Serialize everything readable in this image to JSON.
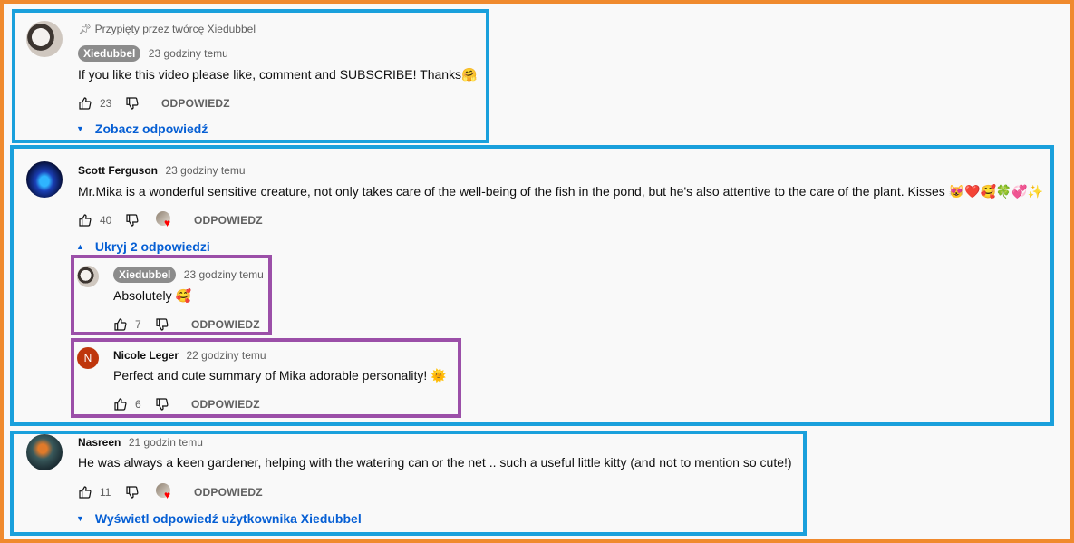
{
  "comments": [
    {
      "pinned_label": "Przypięty przez twórcę Xiedubbel",
      "author": "Xiedubbel",
      "time": "23 godziny temu",
      "text": "If you like this video please like, comment and SUBSCRIBE! Thanks🤗",
      "likes": "23",
      "reply_label": "ODPOWIEDZ",
      "toggle_label": "Zobacz odpowiedź"
    },
    {
      "author": "Scott Ferguson",
      "time": "23 godziny temu",
      "text": "Mr.Mika is a wonderful sensitive creature, not only takes care of the well-being of the fish in the pond, but he's also attentive to the care of the plant. Kisses 😻❤️🥰🍀💞✨",
      "likes": "40",
      "reply_label": "ODPOWIEDZ",
      "toggle_label": "Ukryj 2 odpowiedzi",
      "replies": [
        {
          "author": "Xiedubbel",
          "time": "23 godziny temu",
          "text": "Absolutely 🥰",
          "likes": "7",
          "reply_label": "ODPOWIEDZ"
        },
        {
          "author": "Nicole Leger",
          "avatar_letter": "N",
          "time": "22 godziny temu",
          "text": "Perfect and cute summary of Mika adorable personality! 🌞",
          "likes": "6",
          "reply_label": "ODPOWIEDZ"
        }
      ]
    },
    {
      "author": "Nasreen",
      "time": "21 godzin temu",
      "text": "He was always a keen gardener, helping with the watering can or  the net .. such a useful little kitty (and not to mention so cute!)",
      "likes": "11",
      "reply_label": "ODPOWIEDZ",
      "toggle_label": "Wyświetl odpowiedź użytkownika Xiedubbel"
    }
  ],
  "colors": {
    "outer_frame": "#f08a2e",
    "comment_box": "#1aa0dc",
    "reply_box": "#9b4fa8",
    "link": "#065fd4",
    "creator_badge": "#8c8c8c",
    "heart": "#ff0000"
  }
}
